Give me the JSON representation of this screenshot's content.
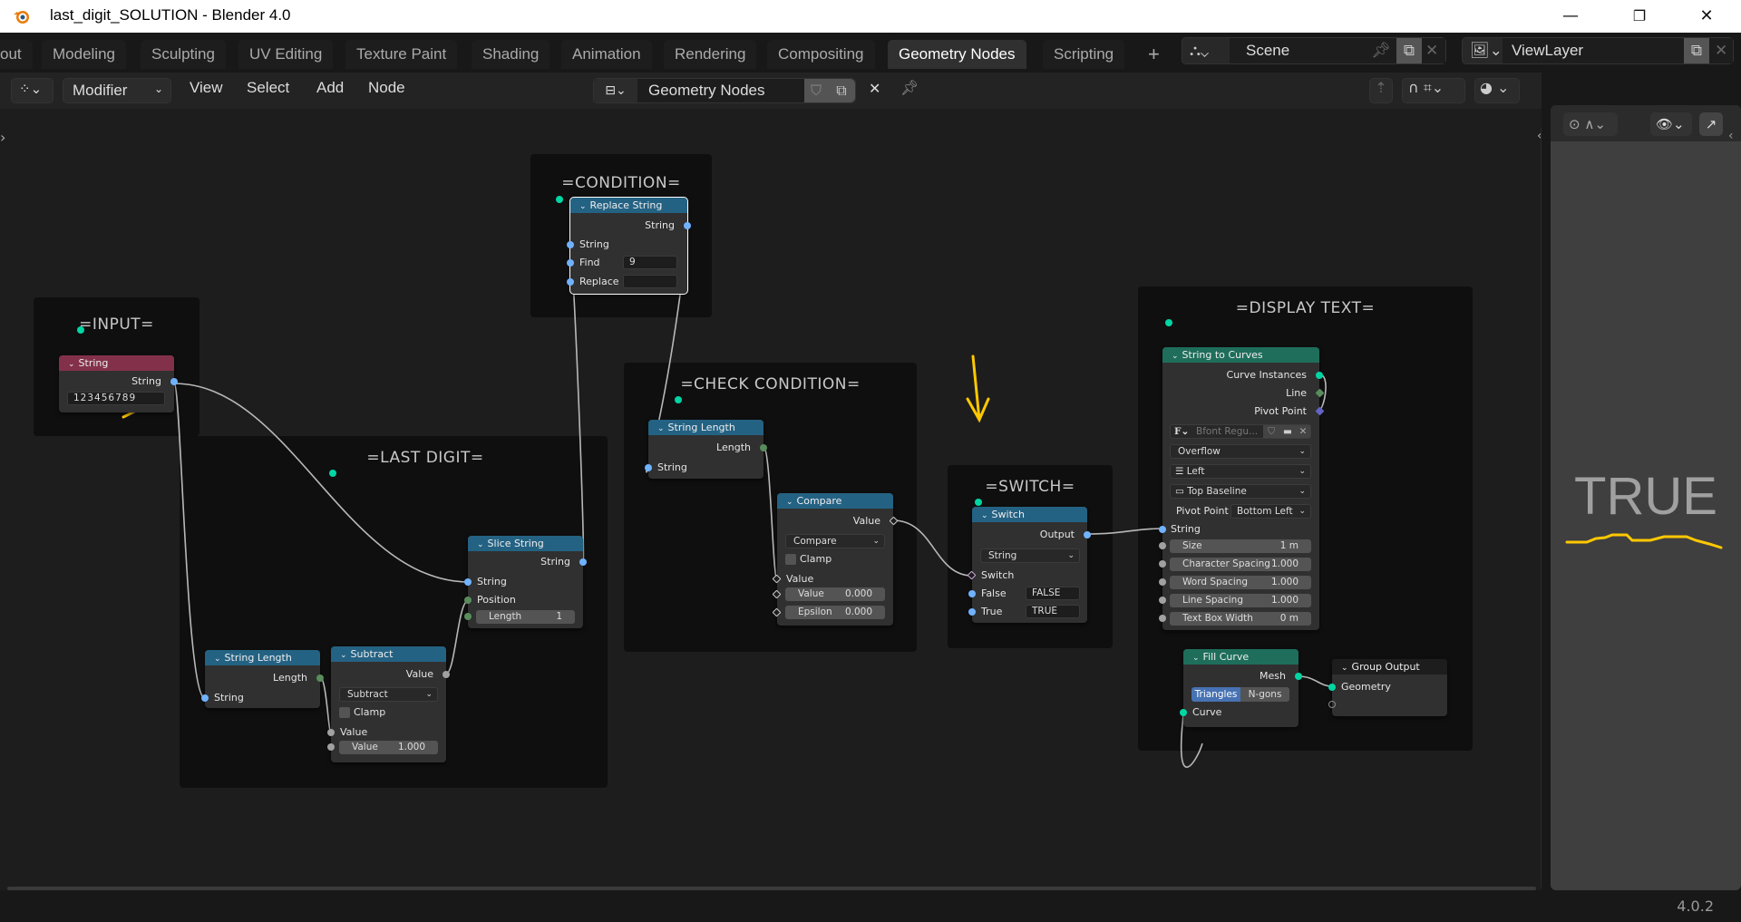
{
  "window": {
    "title": "last_digit_SOLUTION   - Blender 4.0",
    "controls": [
      "minimize",
      "maximize",
      "close"
    ]
  },
  "workspaces": {
    "tabs": [
      "out",
      "Modeling",
      "Sculpting",
      "UV Editing",
      "Texture Paint",
      "Shading",
      "Animation",
      "Rendering",
      "Compositing",
      "Geometry Nodes",
      "Scripting"
    ],
    "active": "Geometry Nodes",
    "add_label": "+"
  },
  "scene": {
    "name": "Scene",
    "view_layer": "ViewLayer"
  },
  "editor_header": {
    "context": "Modifier",
    "menus": [
      "View",
      "Select",
      "Add",
      "Node"
    ],
    "node_group": "Geometry Nodes"
  },
  "frames": {
    "input": "=INPUT=",
    "last_digit": "=LAST DIGIT=",
    "condition": "=CONDITION=",
    "check_condition": "=CHECK CONDITION=",
    "switch": "=SWITCH=",
    "display_text": "=DISPLAY TEXT="
  },
  "nodes": {
    "string_input": {
      "title": "String",
      "output": "String",
      "value": "123456789"
    },
    "replace_string": {
      "title": "Replace String",
      "output": "String",
      "in_string": "String",
      "find_label": "Find",
      "find_value": "9",
      "replace_label": "Replace",
      "replace_value": ""
    },
    "string_length_last": {
      "title": "String Length",
      "output": "Length",
      "input": "String"
    },
    "subtract": {
      "title": "Subtract",
      "output": "Value",
      "operation": "Subtract",
      "clamp": "Clamp",
      "in1": "Value",
      "in2_label": "Value",
      "in2_value": "1.000"
    },
    "slice_string": {
      "title": "Slice String",
      "output": "String",
      "in_string": "String",
      "position": "Position",
      "length_label": "Length",
      "length_value": "1"
    },
    "string_length_check": {
      "title": "String Length",
      "output": "Length",
      "input": "String"
    },
    "compare": {
      "title": "Compare",
      "output": "Value",
      "operation": "Compare",
      "clamp": "Clamp",
      "in1": "Value",
      "in2_label": "Value",
      "in2_value": "0.000",
      "eps_label": "Epsilon",
      "eps_value": "0.000"
    },
    "switch": {
      "title": "Switch",
      "output": "Output",
      "type": "String",
      "switch": "Switch",
      "false_label": "False",
      "false_value": "FALSE",
      "true_label": "True",
      "true_value": "TRUE"
    },
    "string_to_curves": {
      "title": "String to Curves",
      "outputs": [
        "Curve Instances",
        "Line",
        "Pivot Point"
      ],
      "font": "Bfont Regu...",
      "overflow": "Overflow",
      "align_x": "Left",
      "align_y": "Top Baseline",
      "pivot_label": "Pivot Point",
      "pivot_value": "Bottom Left",
      "in_string": "String",
      "params": [
        {
          "label": "Size",
          "value": "1 m"
        },
        {
          "label": "Character Spacing",
          "value": "1.000"
        },
        {
          "label": "Word Spacing",
          "value": "1.000"
        },
        {
          "label": "Line Spacing",
          "value": "1.000"
        },
        {
          "label": "Text Box Width",
          "value": "0 m"
        }
      ]
    },
    "fill_curve": {
      "title": "Fill Curve",
      "output": "Mesh",
      "mode_a": "Triangles",
      "mode_b": "N-gons",
      "active_mode": "Triangles",
      "input": "Curve"
    },
    "group_output": {
      "title": "Group Output",
      "input": "Geometry"
    }
  },
  "viewport": {
    "result_text": "TRUE"
  },
  "status": {
    "version": "4.0.2"
  },
  "colors": {
    "header_input": "#83314a",
    "header_converter": "#246283",
    "header_geometry": "#1e6e5b",
    "socket_string": "#70b2ff",
    "socket_int": "#598c5c",
    "socket_float": "#a1a1a1",
    "socket_geometry": "#00d6a3",
    "socket_bool": "#cca6d6",
    "socket_vector": "#6363c7",
    "annotation": "#ffc800"
  }
}
